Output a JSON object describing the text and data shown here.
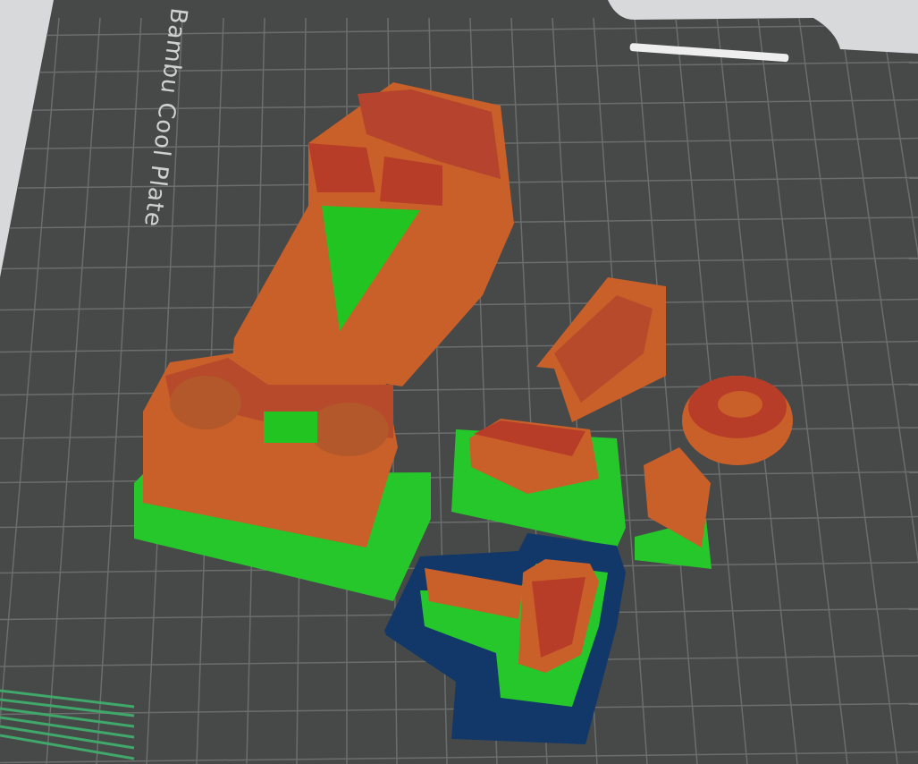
{
  "plate": {
    "label": "Bambu Cool Plate"
  }
}
